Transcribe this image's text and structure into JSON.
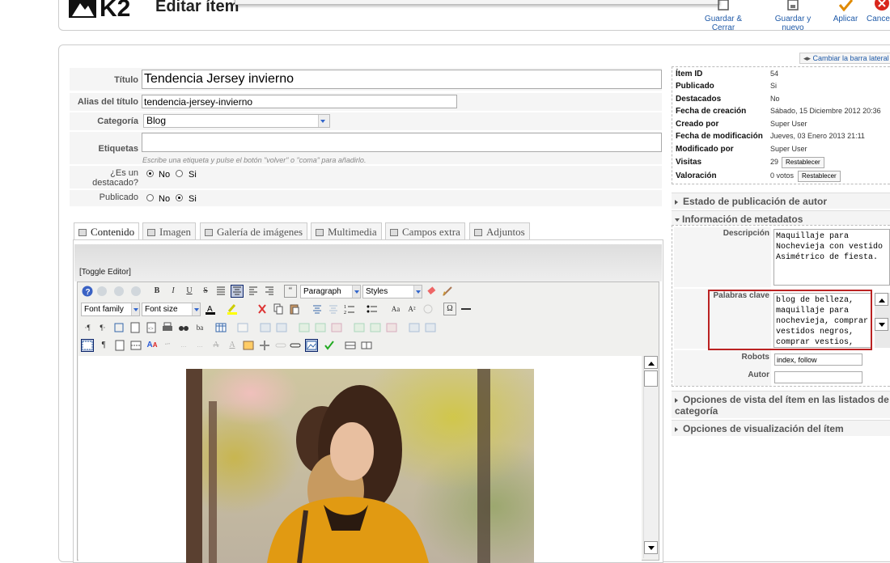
{
  "header": {
    "title": "Editar ítem",
    "logo_text": "K2",
    "buttons": [
      {
        "label": "Guardar & Cerrar"
      },
      {
        "label": "Guardar y nuevo"
      },
      {
        "label": "Aplicar"
      },
      {
        "label": "Cancelar"
      }
    ]
  },
  "form": {
    "title_label": "Título",
    "title_value": "Tendencia Jersey invierno",
    "alias_label": "Alias del título",
    "alias_value": "tendencia-jersey-invierno",
    "category_label": "Categoría",
    "category_value": "Blog",
    "tags_label": "Etiquetas",
    "tags_hint": "Escribe una etiqueta y pulse el botón \"volver\" o \"coma\" para añadirlo.",
    "featured_label_1": "¿Es un",
    "featured_label_2": "destacado?",
    "featured_no": "No",
    "featured_si": "Si",
    "published_label": "Publicado",
    "published_no": "No",
    "published_si": "Si"
  },
  "tabs": [
    {
      "label": "Contenido",
      "active": true
    },
    {
      "label": "Imagen"
    },
    {
      "label": "Galería de imágenes"
    },
    {
      "label": "Multimedia"
    },
    {
      "label": "Campos extra"
    },
    {
      "label": "Adjuntos"
    }
  ],
  "editor": {
    "toggle_label": "[Toggle Editor]",
    "format_select": "Paragraph",
    "styles_select": "Styles",
    "font_family_select": "Font family",
    "font_size_select": "Font size",
    "tool_b": "B",
    "tool_i": "I",
    "tool_u": "U",
    "tool_s": "S",
    "tool_quote": "“",
    "tool_omega": "Ω",
    "tool_aa": "Aa",
    "tool_sup": "A²",
    "tool_ltr": "·¶",
    "tool_rtl": "¶·",
    "tool_ba": "ba",
    "tool_para": "¶",
    "tool_big_a": "A"
  },
  "sidebar": {
    "toggle_label": "Cambiar la barra lateral",
    "info": {
      "item_id_label": "Ítem ID",
      "item_id": "54",
      "published_label": "Publicado",
      "published": "Si",
      "featured_label": "Destacados",
      "featured": "No",
      "created_date_label": "Fecha de creación",
      "created_date": "Sábado, 15 Diciembre 2012 20:36",
      "created_by_label": "Creado por",
      "created_by": "Super User",
      "modified_date_label": "Fecha de modificación",
      "modified_date": "Jueves, 03 Enero 2013 21:11",
      "modified_by_label": "Modificado por",
      "modified_by": "Super User",
      "hits_label": "Visitas",
      "hits": "29",
      "rating_label": "Valoración",
      "rating": "0 votos",
      "reset_label": "Restablecer"
    },
    "author_publishing_section": "Estado de publicación de autor",
    "metadata_section": "Información de metadatos",
    "metadata": {
      "description_label": "Descripción",
      "description_value": "Maquillaje para Nochevieja con vestido Asimétrico de fiesta.",
      "keywords_label": "Palabras clave",
      "keywords_value": "blog de belleza, maquillaje para nochevieja, comprar vestidos negros, comprar vestios,",
      "robots_label": "Robots",
      "robots_value": "index, follow",
      "author_label": "Autor",
      "author_value": ""
    },
    "category_view_section": "Opciones de vista del ítem en las listados de categoría",
    "item_view_section": "Opciones de visualización del ítem"
  }
}
